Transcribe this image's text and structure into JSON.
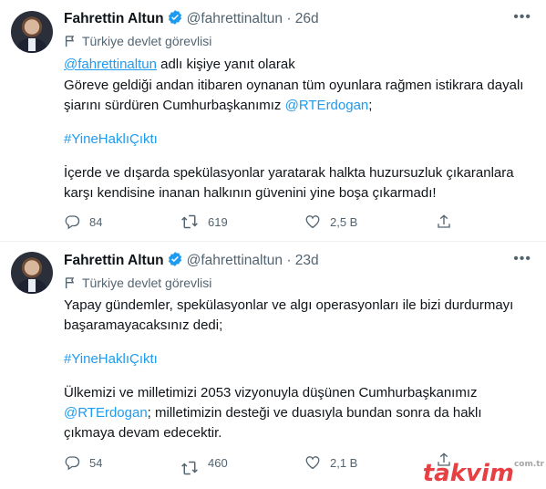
{
  "tweets": [
    {
      "author_name": "Fahrettin Altun",
      "handle": "@fahrettinaltun",
      "separator": "·",
      "time": "26d",
      "label": "Türkiye devlet görevlisi",
      "reply_mention": "@fahrettinaltun",
      "reply_text": " adlı kişiye yanıt olarak",
      "body": {
        "line1": "Göreve geldiği andan itibaren oynanan tüm oyunlara rağmen istikrara dayalı",
        "line2_text": "şiarını sürdüren Cumhurbaşkanımız ",
        "line2_mention": "@RTErdogan",
        "line2_end": ";",
        "hashtag": "#YineHaklıÇıktı",
        "line4": "İçerde ve dışarda spekülasyonlar yaratarak halkta huzursuzluk çıkaranlara",
        "line5": "karşı kendisine inanan halkının güvenini yine boşa çıkarmadı!"
      },
      "stats": {
        "replies": "84",
        "retweets": "619",
        "likes": "2,5 B"
      }
    },
    {
      "author_name": "Fahrettin Altun",
      "handle": "@fahrettinaltun",
      "separator": "·",
      "time": "23d",
      "label": "Türkiye devlet görevlisi",
      "body": {
        "line1": "Yapay gündemler, spekülasyonlar ve algı operasyonları ile bizi durdurmayı",
        "line2": "başaramayacaksınız dedi;",
        "hashtag": "#YineHaklıÇıktı",
        "line4": "Ülkemizi ve milletimizi 2053 vizyonuyla düşünen Cumhurbaşkanımız",
        "line5_mention": "@RTErdogan",
        "line5_text": "; milletimizin desteği ve duasıyla bundan sonra da haklı",
        "line6": "çıkmaya devam edecektir."
      },
      "stats": {
        "replies": "54",
        "retweets": "460",
        "likes": "2,1 B"
      }
    }
  ],
  "watermark": {
    "brand": "takvim",
    "tld": "com.tr"
  },
  "colors": {
    "link": "#1d9bf0",
    "muted": "#536471",
    "verified": "#1d9bf0",
    "watermark": "#e3262a"
  },
  "icons": [
    "more-icon",
    "verified-badge-icon",
    "flag-icon",
    "reply-icon",
    "retweet-icon",
    "like-icon",
    "share-icon"
  ]
}
